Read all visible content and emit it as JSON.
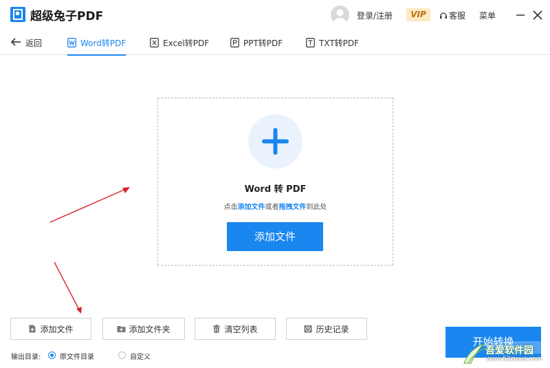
{
  "app": {
    "title": "超级兔子PDF"
  },
  "header": {
    "login_label": "登录/注册",
    "vip_label": "VIP",
    "service_label": "客服",
    "menu_label": "菜单"
  },
  "tabs": [
    {
      "label": "返回",
      "icon": "back-arrow-icon"
    },
    {
      "label": "Word转PDF",
      "icon": "word-icon",
      "active": true
    },
    {
      "label": "Excel转PDF",
      "icon": "excel-icon"
    },
    {
      "label": "PPT转PDF",
      "icon": "ppt-icon"
    },
    {
      "label": "TXT转PDF",
      "icon": "txt-icon"
    }
  ],
  "dropzone": {
    "title": "Word 转 PDF",
    "hint_prefix": "点击",
    "hint_add": "添加文件",
    "hint_or": "或者",
    "hint_drag": "拖拽文件",
    "hint_suffix": "到此处",
    "add_button": "添加文件"
  },
  "toolbar": {
    "add_file": "添加文件",
    "add_folder": "添加文件夹",
    "clear_list": "清空列表",
    "history": "历史记录"
  },
  "output": {
    "label": "输出目录:",
    "options": [
      {
        "label": "原文件目录",
        "selected": true
      },
      {
        "label": "自定义",
        "selected": false
      }
    ]
  },
  "start_button": "开始转换",
  "watermark": {
    "name": "吾爱软件园",
    "url": "www.52zixue.com"
  },
  "colors": {
    "accent": "#1a86f0",
    "vip_bg": "#fde9c2",
    "vip_text": "#b3720e",
    "annotation": "#d9232d"
  }
}
